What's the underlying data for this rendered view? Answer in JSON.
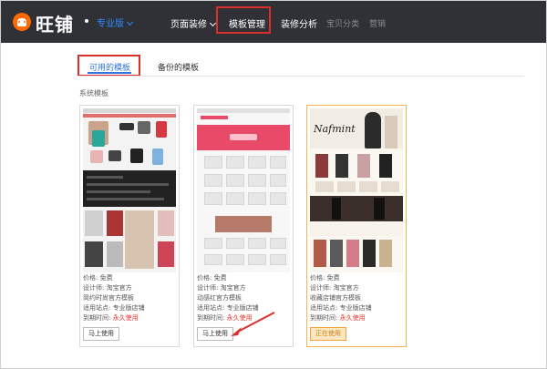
{
  "brand": {
    "logo_text": "旺铺",
    "edition": "专业版"
  },
  "nav": {
    "items": [
      {
        "label": "页面装修"
      },
      {
        "label": "模板管理"
      },
      {
        "label": "装修分析"
      },
      {
        "label": "宝贝分类"
      },
      {
        "label": "营销"
      }
    ]
  },
  "tabs": [
    {
      "label": "可用的模板"
    },
    {
      "label": "备份的模板"
    }
  ],
  "section_label": "系统模板",
  "templates": [
    {
      "price": "价格: 免费",
      "designer": "设计师: 淘宝官方",
      "name": "简约时尚官方模板",
      "applicable": "适用站点: 专业版店铺",
      "expiry_prefix": "到期时间: ",
      "expiry_value": "永久使用",
      "button": "马上使用"
    },
    {
      "price": "价格: 免费",
      "designer": "设计师: 淘宝官方",
      "name": "动感红官方模板",
      "applicable": "适用站点: 专业版店铺",
      "expiry_prefix": "到期时间: ",
      "expiry_value": "永久使用",
      "button": "马上使用"
    },
    {
      "price": "价格: 免费",
      "designer": "设计师: 淘宝官方",
      "name": "收藏店铺官方模板",
      "applicable": "适用站点: 专业版店铺",
      "expiry_prefix": "到期时间: ",
      "expiry_value": "永久使用",
      "button": "正在使用"
    }
  ],
  "thumbnail_logo_text": "Nafmint",
  "colors": {
    "nav_bg": "#2f3136",
    "brand_orange": "#ff6a00",
    "highlight_red": "#d9302b",
    "link_blue": "#2f74d9",
    "expiry_red": "#e0352b",
    "selected_border": "#f2b84b"
  }
}
